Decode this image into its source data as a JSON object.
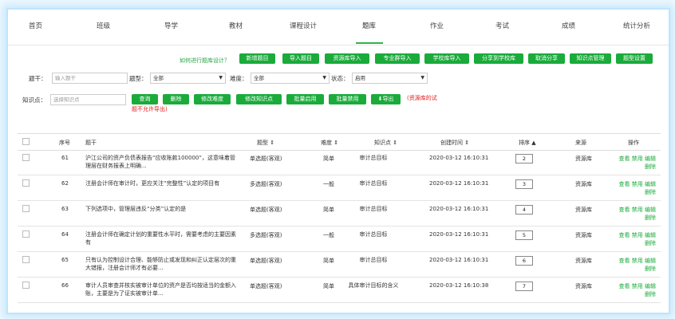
{
  "nav": [
    "首页",
    "班级",
    "导学",
    "教材",
    "课程设计",
    "题库",
    "作业",
    "考试",
    "成绩",
    "统计分析"
  ],
  "help_link": "如何进行题库设计？",
  "top_buttons": [
    "新增题目",
    "导入题目",
    "资源库导入",
    "专业群导入",
    "学校库导入",
    "分享到学校库",
    "取消分享",
    "知识点管理",
    "题型设置"
  ],
  "filters": {
    "stem_label": "题干：",
    "stem_placeholder": "输入题干",
    "type_label": "题型：",
    "type_value": "全部",
    "difficulty_label": "难度：",
    "difficulty_value": "全部",
    "status_label": "状态：",
    "status_value": "启用",
    "kp_label": "知识点：",
    "kp_placeholder": "选择知识点"
  },
  "action_buttons": [
    "查询",
    "删除",
    "修改难度",
    "修改知识点",
    "批量启用",
    "批量禁用",
    "导出"
  ],
  "export_warning_line1": "(资源库的试",
  "export_warning_line2": "题不允许导出)",
  "table": {
    "headers": {
      "seq": "序号",
      "stem": "题干",
      "type": "题型 ⇕",
      "difficulty": "难度 ⇕",
      "kp": "知识点 ⇕",
      "created": "创建时间 ⇕",
      "sort": "排序 ▲",
      "source": "来源",
      "ops": "操作"
    },
    "rows": [
      {
        "seq": "61",
        "stem": "沪江公司的资产负债表报告“应收账款100000”，这意味着管理层在财务报表上明确...",
        "type": "单选题(客观)",
        "difficulty": "简单",
        "kp": "审计总目标",
        "created": "2020-03-12 16:10:31",
        "sort": "2",
        "source": "资源库"
      },
      {
        "seq": "62",
        "stem": "注册会计师在审计时，更应关注“完整性”认定的项目有",
        "type": "多选题(客观)",
        "difficulty": "一般",
        "kp": "审计总目标",
        "created": "2020-03-12 16:10:31",
        "sort": "3",
        "source": "资源库"
      },
      {
        "seq": "63",
        "stem": "下列选项中，管理层违反“分类”认定的是",
        "type": "单选题(客观)",
        "difficulty": "简单",
        "kp": "审计总目标",
        "created": "2020-03-12 16:10:31",
        "sort": "4",
        "source": "资源库"
      },
      {
        "seq": "64",
        "stem": "注册会计师在确定计划的重要性水平时，需要考虑的主要因素有",
        "type": "多选题(客观)",
        "difficulty": "一般",
        "kp": "审计总目标",
        "created": "2020-03-12 16:10:31",
        "sort": "5",
        "source": "资源库"
      },
      {
        "seq": "65",
        "stem": "只有认为控制设计合理、能够防止或发现和纠正认定层次的重大错报，注册会计师才有必要...",
        "type": "单选题(客观)",
        "difficulty": "简单",
        "kp": "审计总目标",
        "created": "2020-03-12 16:10:31",
        "sort": "6",
        "source": "资源库"
      },
      {
        "seq": "66",
        "stem": "审计人员审查并核实被审计单位的资产是否均按适当的金额入账，主要是为了证实被审计单...",
        "type": "单选题(客观)",
        "difficulty": "简单",
        "kp": "具体审计目标的含义",
        "created": "2020-03-12 16:10:38",
        "sort": "7",
        "source": "资源库"
      }
    ],
    "op_view": "查看",
    "op_disable": "禁用",
    "op_edit": "编辑",
    "op_delete": "删除"
  },
  "colors": {
    "accent": "#1aab3b",
    "warning": "#e02020",
    "frame_glow": "#bfe4fb"
  }
}
